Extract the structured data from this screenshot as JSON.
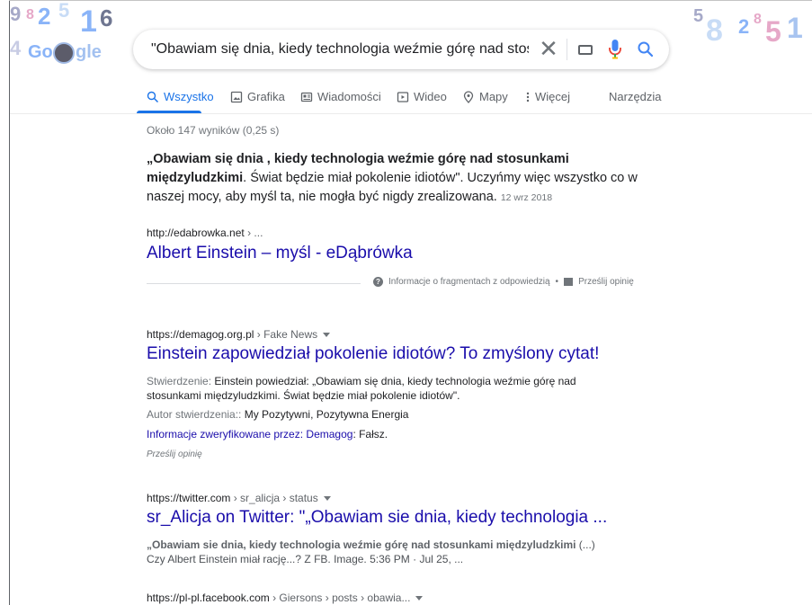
{
  "search": {
    "query": "\"Obawiam się dnia, kiedy technologia weźmie górę nad stosunkami m",
    "clear_glyph": "✕"
  },
  "logo": {
    "digits_left": [
      "9",
      "8",
      "2",
      "5",
      "1",
      "6",
      "4"
    ],
    "goog": "Go",
    "gle": "gle",
    "digits_right": [
      "5",
      "8",
      "2",
      "8",
      "5",
      "1"
    ]
  },
  "tabs": [
    {
      "label": "Wszystko",
      "icon": "search-icon",
      "active": true
    },
    {
      "label": "Grafika",
      "icon": "image-icon",
      "active": false
    },
    {
      "label": "Wiadomości",
      "icon": "news-icon",
      "active": false
    },
    {
      "label": "Wideo",
      "icon": "video-icon",
      "active": false
    },
    {
      "label": "Mapy",
      "icon": "map-pin-icon",
      "active": false
    },
    {
      "label": "Więcej",
      "icon": "more-vert-icon",
      "active": false
    },
    {
      "label": "Narzędzia",
      "icon": "",
      "active": false
    }
  ],
  "stats": "Około 147 wyników (0,25 s)",
  "featured": {
    "bold_text": "„Obawiam się dnia , kiedy technologia weźmie górę nad stosunkami międzyludzkimi",
    "rest_text": ". Świat będzie miał pokolenie idiotów\". Uczyńmy więc wszystko co w naszej mocy, aby myśl ta, nie mogła być nigdy zrealizowana.",
    "date": "12 wrz 2018",
    "url": "http://edabrowka.net",
    "url_crumb": " › ...",
    "title": "Albert Einstein – myśl - eDąbrówka",
    "feedback_info": "Informacje o fragmentach z odpowiedzią",
    "feedback_dot": "•",
    "feedback_send": "Prześlij opinię"
  },
  "result2": {
    "url": "https://demagog.org.pl",
    "url_crumb": " › Fake News",
    "title": "Einstein zapowiedział pokolenie idiotów? To zmyślony cytat!",
    "claim_label": "Stwierdzenie: ",
    "claim_text": "Einstein powiedział: „Obawiam się dnia, kiedy technologia weźmie górę nad stosunkami międzyludzkimi. Świat będzie miał pokolenie idiotów\".",
    "author_label": "Autor stwierdzenia:: ",
    "author_text": "My Pozytywni, Pozytywna Energia",
    "verified_label": "Informacje zweryfikowane przez: Demagog",
    "verified_text": ": Fałsz.",
    "feedback": "Prześlij opinię"
  },
  "result3": {
    "url": "https://twitter.com",
    "url_crumb": " › sr_alicja › status",
    "title": "sr_Alicja on Twitter: \"„Obawiam sie dnia, kiedy technologia ...",
    "desc_bold": "„Obawiam sie dnia, kiedy technologia weźmie górę nad stosunkami międzyludzkimi",
    "desc_bold_tail": " (...)",
    "desc_line2": "Czy Albert Einstein miał rację...? Z FB. Image. 5:36 PM · Jul 25, ..."
  },
  "result4": {
    "url": "https://pl-pl.facebook.com",
    "url_crumb": " › Giersons › posts › obawia..."
  },
  "colors": {
    "link": "#1a0dab",
    "accent": "#1a73e8",
    "muted": "#70757a"
  }
}
